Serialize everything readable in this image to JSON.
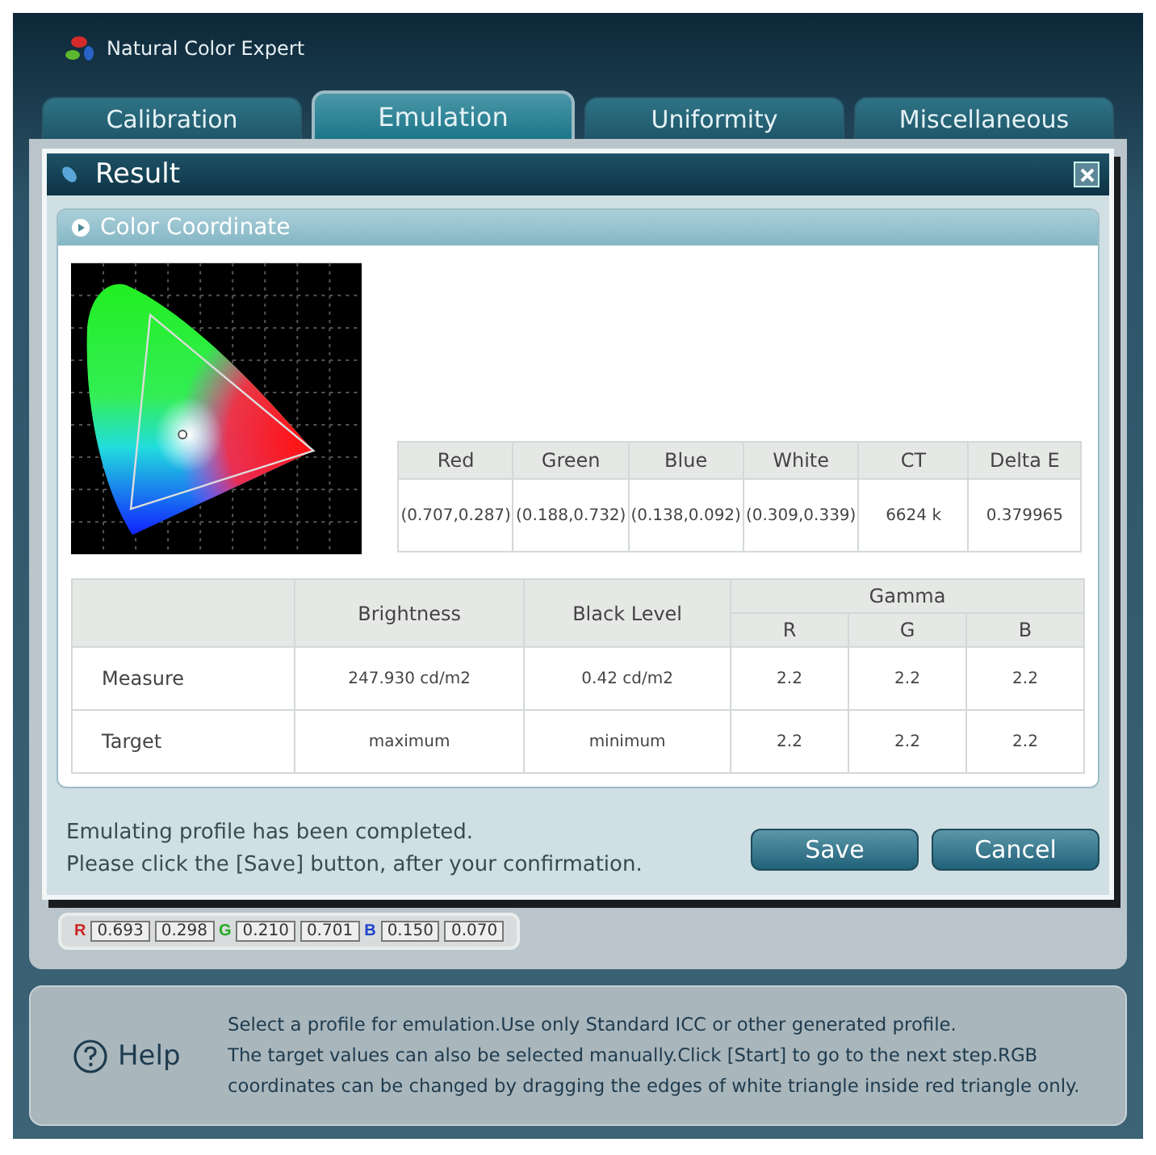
{
  "app": {
    "title": "Natural Color Expert"
  },
  "tabs": [
    {
      "label": "Calibration",
      "selected": false
    },
    {
      "label": "Emulation",
      "selected": true
    },
    {
      "label": "Uniformity",
      "selected": false
    },
    {
      "label": "Miscellaneous",
      "selected": false
    }
  ],
  "dialog": {
    "title": "Result",
    "section_title": "Color Coordinate",
    "coordinates": {
      "columns": [
        "Red",
        "Green",
        "Blue",
        "White",
        "CT",
        "Delta E"
      ],
      "values": [
        "(0.707,0.287)",
        "(0.188,0.732)",
        "(0.138,0.092)",
        "(0.309,0.339)",
        "6624 k",
        "0.379965"
      ]
    },
    "results": {
      "columns": [
        "Brightness",
        "Black Level"
      ],
      "group": "Gamma",
      "subcolumns": [
        "R",
        "G",
        "B"
      ],
      "rows": [
        {
          "label": "Measure",
          "cells": [
            "247.930 cd/m2",
            "0.42 cd/m2",
            "2.2",
            "2.2",
            "2.2"
          ]
        },
        {
          "label": "Target",
          "cells": [
            "maximum",
            "minimum",
            "2.2",
            "2.2",
            "2.2"
          ]
        }
      ]
    },
    "message_lines": [
      "Emulating profile has been completed.",
      "Please click the [Save] button, after your confirmation."
    ],
    "buttons": [
      "Save",
      "Cancel"
    ]
  },
  "background_coordinates": [
    {
      "channel": "R",
      "color": "#cc2222",
      "values": [
        "0.693",
        "0.298"
      ]
    },
    {
      "channel": "G",
      "color": "#22aa22",
      "values": [
        "0.210",
        "0.701"
      ]
    },
    {
      "channel": "B",
      "color": "#2244cc",
      "values": [
        "0.150",
        "0.070"
      ]
    }
  ],
  "help": {
    "label": "Help",
    "lines": [
      "Select a profile for emulation.Use only Standard ICC or other generated profile.",
      "The target values can also be selected manually.Click [Start] to go to the next step.RGB",
      "coordinates can be changed by dragging the edges of white triangle inside red triangle only."
    ]
  }
}
